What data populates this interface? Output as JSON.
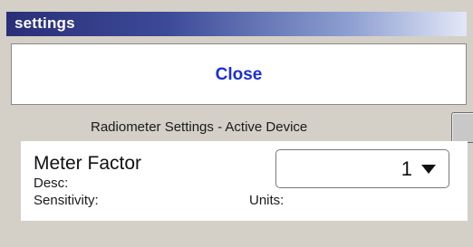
{
  "window": {
    "title": "settings"
  },
  "close_button": {
    "label": "Close"
  },
  "section": {
    "header": "Radiometer Settings - Active Device"
  },
  "device": {
    "meter_factor_label": "Meter Factor",
    "desc_label": "Desc:",
    "sensitivity_label": "Sensitivity:",
    "units_label": "Units:",
    "meter_factor_select": {
      "selected": "1",
      "caret_icon": "chevron-down-icon"
    }
  },
  "colors": {
    "title_bar_start": "#2a2f77",
    "title_bar_end": "#e3e8f6",
    "close_text": "#1c2fd0",
    "background": "#d4d0c8"
  }
}
